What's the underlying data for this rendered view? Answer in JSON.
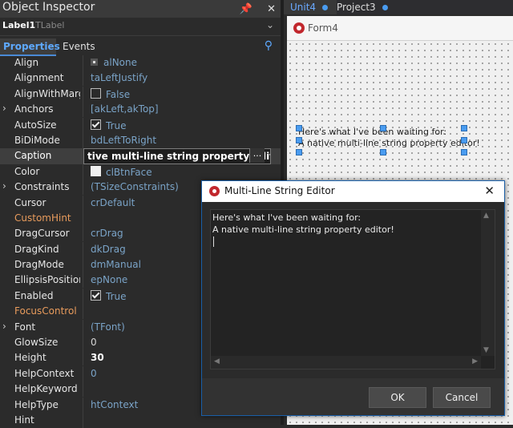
{
  "inspector": {
    "title": "Object Inspector",
    "pin_icon": "pin-icon",
    "close_icon": "close-icon",
    "component_name": "Label1",
    "component_class": "TLabel",
    "tabs": [
      "Properties",
      "Events"
    ],
    "properties": [
      {
        "name": "Align",
        "value": "alNone",
        "style": "radio"
      },
      {
        "name": "Alignment",
        "value": "taLeftJustify"
      },
      {
        "name": "AlignWithMargins",
        "value": "False",
        "style": "checkbox"
      },
      {
        "name": "Anchors",
        "value": "[akLeft,akTop]",
        "expandable": true
      },
      {
        "name": "AutoSize",
        "value": "True",
        "style": "checkbox-checked"
      },
      {
        "name": "BiDiMode",
        "value": "bdLeftToRight"
      },
      {
        "name": "Caption",
        "value": "tive multi-line string property editor!",
        "selected": true
      },
      {
        "name": "Color",
        "value": "clBtnFace",
        "style": "swatch"
      },
      {
        "name": "Constraints",
        "value": "(TSizeConstraints)",
        "expandable": true
      },
      {
        "name": "Cursor",
        "value": "crDefault"
      },
      {
        "name": "CustomHint",
        "value": "",
        "orange": true
      },
      {
        "name": "DragCursor",
        "value": "crDrag"
      },
      {
        "name": "DragKind",
        "value": "dkDrag"
      },
      {
        "name": "DragMode",
        "value": "dmManual"
      },
      {
        "name": "EllipsisPosition",
        "value": "epNone"
      },
      {
        "name": "Enabled",
        "value": "True",
        "style": "checkbox-checked"
      },
      {
        "name": "FocusControl",
        "value": "",
        "orange": true
      },
      {
        "name": "Font",
        "value": "(TFont)",
        "expandable": true
      },
      {
        "name": "GlowSize",
        "value": "0",
        "plain": true
      },
      {
        "name": "Height",
        "value": "30",
        "bold": true
      },
      {
        "name": "HelpContext",
        "value": "0"
      },
      {
        "name": "HelpKeyword",
        "value": ""
      },
      {
        "name": "HelpType",
        "value": "htContext"
      },
      {
        "name": "Hint",
        "value": ""
      }
    ],
    "ellipsis": "..."
  },
  "designer": {
    "tabs": [
      "Unit4",
      "Project3"
    ],
    "form_title": "Form4",
    "label_text": "Here's what I've been waiting for:\nA native multi-line string property editor!"
  },
  "dialog": {
    "title": "Multi-Line String Editor",
    "close_glyph": "✕",
    "text": "Here's what I've been waiting for:\nA native multi-line string property editor!",
    "ok_label": "OK",
    "cancel_label": "Cancel"
  }
}
